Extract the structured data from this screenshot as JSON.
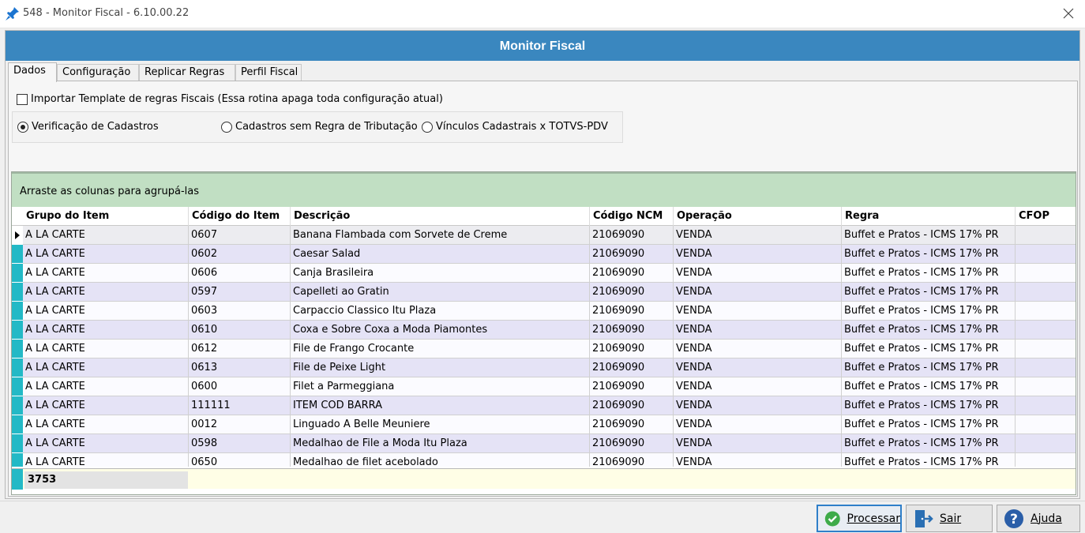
{
  "window": {
    "title": "548 - Monitor Fiscal - 6.10.00.22"
  },
  "header": {
    "title": "Monitor Fiscal"
  },
  "tabs": [
    "Dados",
    "Configuração",
    "Replicar Regras",
    "Perfil Fiscal"
  ],
  "import_checkbox": {
    "label": "Importar Template de regras Fiscais (Essa rotina apaga toda configuração atual)",
    "checked": false
  },
  "radios": [
    {
      "label": "Verificação de Cadastros",
      "selected": true
    },
    {
      "label": "Cadastros sem Regra de Tributação",
      "selected": false
    },
    {
      "label": "Vínculos Cadastrais x TOTVS-PDV",
      "selected": false
    }
  ],
  "grid": {
    "group_hint": "Arraste as colunas para agrupá-las",
    "columns": [
      "Grupo do Item",
      "Código do Item",
      "Descrição",
      "Código NCM",
      "Operação",
      "Regra",
      "CFOP"
    ],
    "rows": [
      [
        "A LA CARTE",
        "0607",
        "Banana Flambada com Sorvete de Creme",
        "21069090",
        "VENDA",
        "Buffet e Pratos - ICMS 17% PR",
        ""
      ],
      [
        "A LA CARTE",
        "0602",
        "Caesar Salad",
        "21069090",
        "VENDA",
        "Buffet e Pratos - ICMS 17% PR",
        ""
      ],
      [
        "A LA CARTE",
        "0606",
        "Canja Brasileira",
        "21069090",
        "VENDA",
        "Buffet e Pratos - ICMS 17% PR",
        ""
      ],
      [
        "A LA CARTE",
        "0597",
        "Capelleti ao Gratin",
        "21069090",
        "VENDA",
        "Buffet e Pratos - ICMS 17% PR",
        ""
      ],
      [
        "A LA CARTE",
        "0603",
        "Carpaccio Classico Itu Plaza",
        "21069090",
        "VENDA",
        "Buffet e Pratos - ICMS 17% PR",
        ""
      ],
      [
        "A LA CARTE",
        "0610",
        "Coxa e Sobre Coxa a Moda Piamontes",
        "21069090",
        "VENDA",
        "Buffet e Pratos - ICMS 17% PR",
        ""
      ],
      [
        "A LA CARTE",
        "0612",
        "File de Frango Crocante",
        "21069090",
        "VENDA",
        "Buffet e Pratos - ICMS 17% PR",
        ""
      ],
      [
        "A LA CARTE",
        "0613",
        "File de Peixe Light",
        "21069090",
        "VENDA",
        "Buffet e Pratos - ICMS 17% PR",
        ""
      ],
      [
        "A LA CARTE",
        "0600",
        "Filet a Parmeggiana",
        "21069090",
        "VENDA",
        "Buffet e Pratos - ICMS 17% PR",
        ""
      ],
      [
        "A LA CARTE",
        "111111",
        "ITEM COD BARRA",
        "21069090",
        "VENDA",
        "Buffet e Pratos - ICMS 17% PR",
        ""
      ],
      [
        "A LA CARTE",
        "0012",
        "Linguado A Belle Meuniere",
        "21069090",
        "VENDA",
        "Buffet e Pratos - ICMS 17% PR",
        ""
      ],
      [
        "A LA CARTE",
        "0598",
        "Medalhao de File a Moda Itu Plaza",
        "21069090",
        "VENDA",
        "Buffet e Pratos - ICMS 17% PR",
        ""
      ],
      [
        "A LA CARTE",
        "0650",
        "Medalhao de filet acebolado",
        "21069090",
        "VENDA",
        "Buffet e Pratos - ICMS 17% PR",
        ""
      ]
    ],
    "footer_count": "3753"
  },
  "buttons": {
    "process": "Processar",
    "exit": "Sair",
    "help": "Ajuda"
  },
  "colors": {
    "header": "#3a87bf",
    "group_panel": "#c1dfc3",
    "row_indicator": "#23b9c6",
    "alt_row": "#e5e3f6",
    "footer": "#fffee6"
  },
  "icons": {
    "window": "pin-icon",
    "close": "close-icon",
    "process": "check-circle-icon",
    "exit": "exit-door-icon",
    "help": "help-circle-icon"
  }
}
